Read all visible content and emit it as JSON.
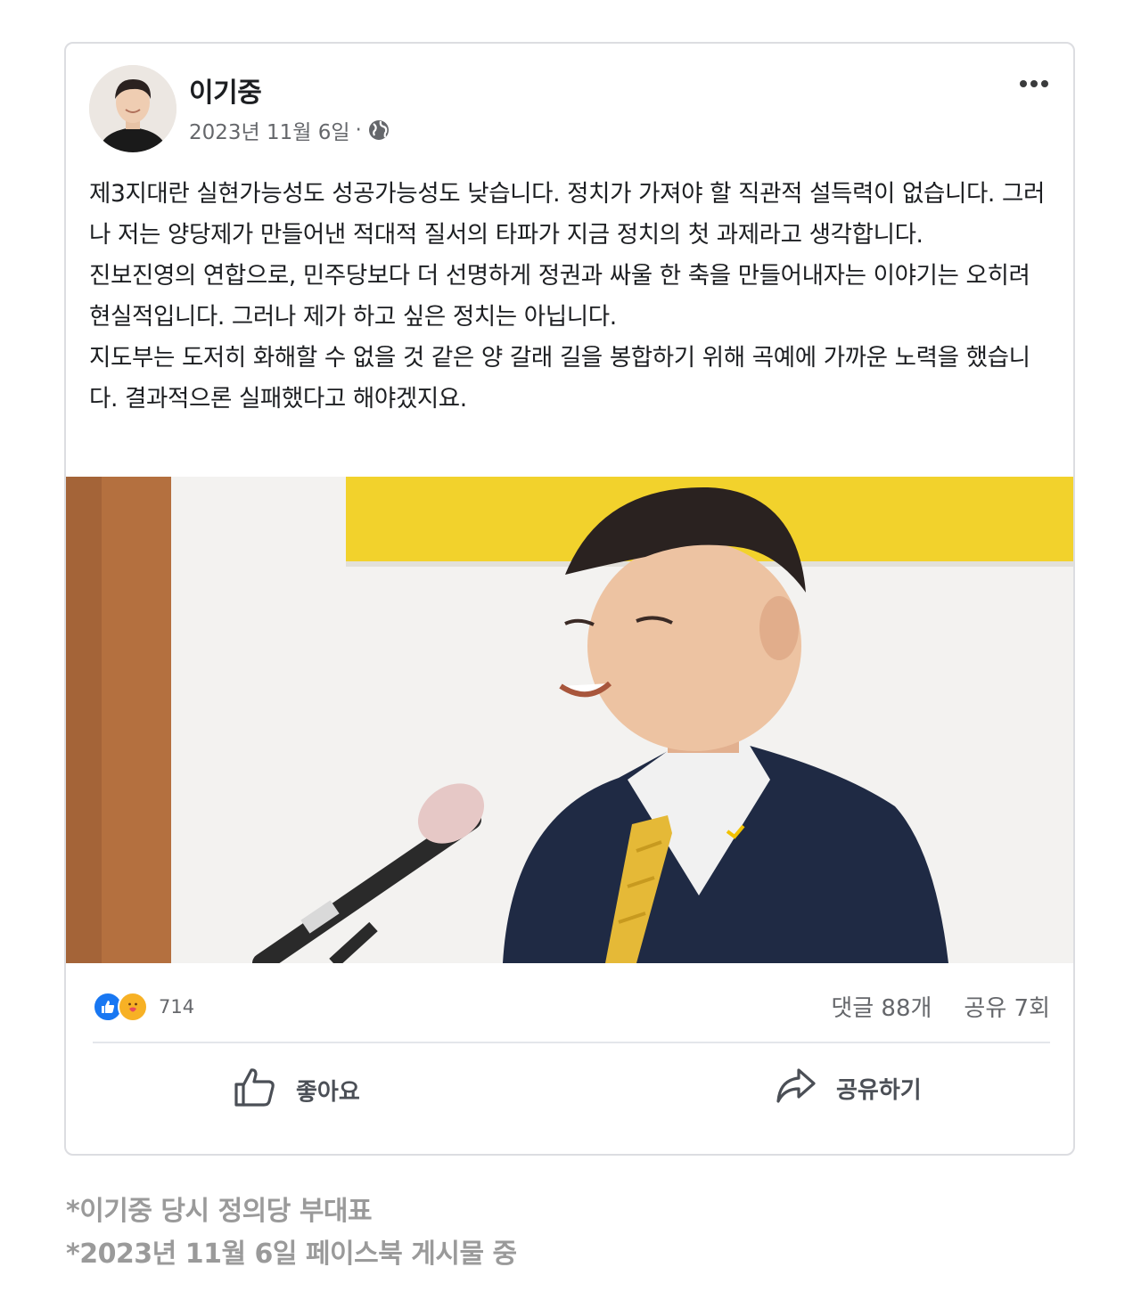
{
  "post": {
    "author": "이기중",
    "date": "2023년 11월 6일",
    "separator": "·",
    "privacy_icon": "globe-icon",
    "more_icon": "more-horizontal-icon",
    "paragraphs": [
      "제3지대란 실현가능성도 성공가능성도 낮습니다. 정치가 가져야 할 직관적 설득력이 없습니다. 그러나 저는 양당제가 만들어낸 적대적 질서의 타파가 지금 정치의 첫 과제라고 생각합니다.",
      "진보진영의 연합으로, 민주당보다 더 선명하게 정권과 싸울 한 축을 만들어내자는 이야기는 오히려 현실적입니다. 그러나 제가 하고 싶은 정치는 아닙니다.",
      "지도부는 도저히 화해할 수 없을 것 같은 양 갈래 길을 봉합하기 위해 곡예에 가까운 노력을 했습니다. 결과적으론 실패했다고 해야겠지요."
    ]
  },
  "reactions": {
    "icons": [
      "like-reaction-icon",
      "care-reaction-icon"
    ],
    "count": "714"
  },
  "stats": {
    "comments": "댓글 88개",
    "shares": "공유 7회"
  },
  "actions": {
    "like_label": "좋아요",
    "share_label": "공유하기"
  },
  "footnotes": [
    "*이기중 당시 정의당 부대표",
    "*2023년 11월 6일 페이스북 게시물 중"
  ],
  "colors": {
    "like_blue": "#1877f2",
    "care_yellow": "#f7b125",
    "banner_yellow": "#f5d730"
  }
}
